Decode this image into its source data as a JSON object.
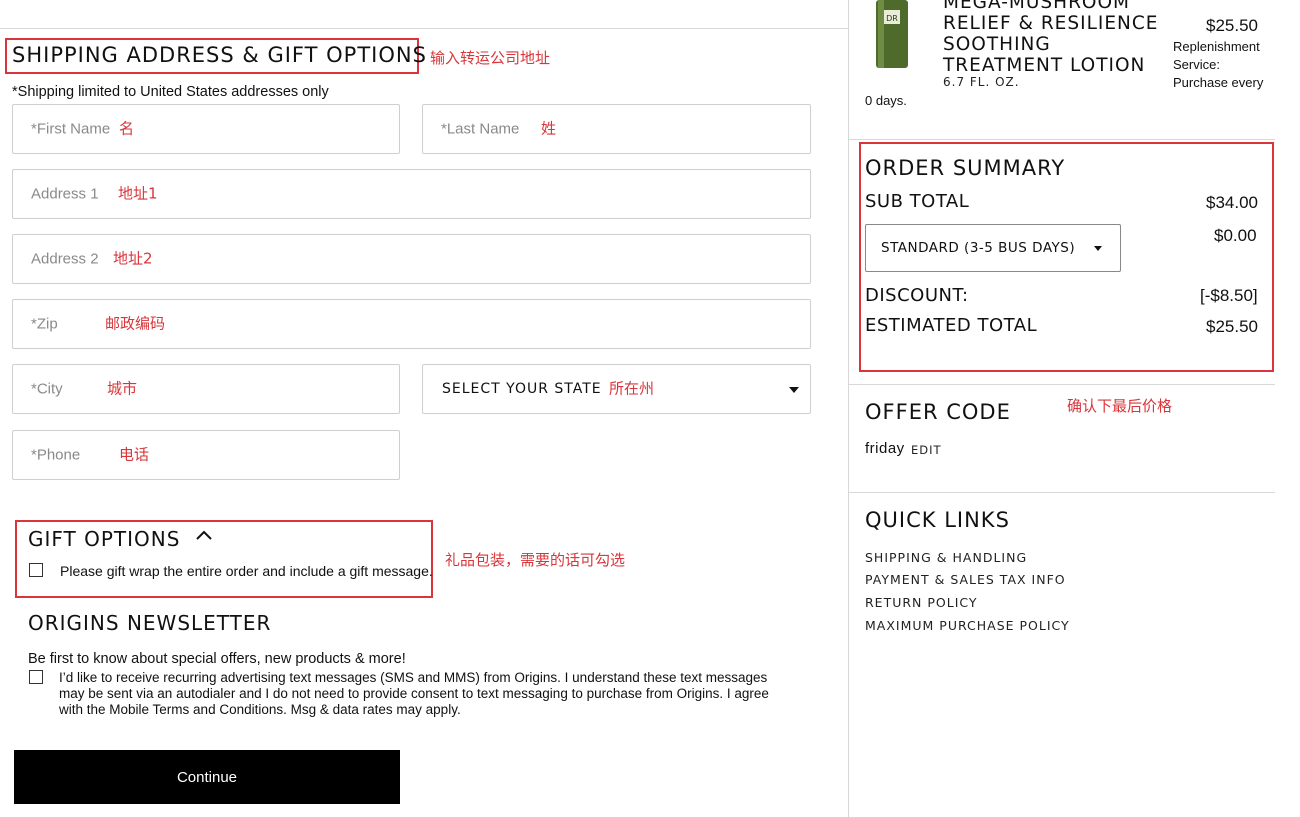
{
  "shipping": {
    "title": "SHIPPING ADDRESS & GIFT OPTIONS",
    "title_note": "输入转运公司地址",
    "restriction": "*Shipping limited to United States addresses only",
    "fields": {
      "first_name": {
        "placeholder": "*First Name",
        "note": "名"
      },
      "last_name": {
        "placeholder": "*Last Name",
        "note": "姓"
      },
      "address1": {
        "placeholder": "Address 1",
        "note": "地址1"
      },
      "address2": {
        "placeholder": "Address 2",
        "note": "地址2"
      },
      "zip": {
        "placeholder": "*Zip",
        "note": "邮政编码"
      },
      "city": {
        "placeholder": "*City",
        "note": "城市"
      },
      "state": {
        "placeholder": "SELECT YOUR STATE",
        "note": "所在州"
      },
      "phone": {
        "placeholder": "*Phone",
        "note": "电话"
      }
    }
  },
  "gift": {
    "title": "GIFT OPTIONS",
    "label": "Please gift wrap the entire order and include a gift message.",
    "note": "礼品包装，需要的话可勾选"
  },
  "newsletter": {
    "title": "ORIGINS NEWSLETTER",
    "intro": "Be first to know about special offers, new products & more!",
    "sms_line1": "I’d like to receive recurring advertising text messages (SMS and MMS) from Origins. I understand these text messages",
    "sms_line2": "may be sent via an autodialer and I do not need to provide consent to text messaging to purchase from Origins. I agree",
    "sms_line3": "with the Mobile Terms and Conditions. Msg & data rates may apply."
  },
  "continue_label": "Continue",
  "product": {
    "name_line1": "MEGA-MUSHROOM",
    "name_line2": "RELIEF & RESILIENCE",
    "name_line3": "SOOTHING",
    "name_line4": "TREATMENT LOTION",
    "size": "6.7 FL. OZ.",
    "price": "$25.50",
    "replenish_line1": "Replenishment",
    "replenish_line2": "Service:",
    "replenish_line3": "Purchase every",
    "days": "0 days."
  },
  "summary": {
    "title": "ORDER SUMMARY",
    "subtotal_label": "SUB TOTAL",
    "subtotal_value": "$34.00",
    "shipping_select": "STANDARD (3-5 BUS DAYS)",
    "shipping_value": "$0.00",
    "discount_label": "DISCOUNT:",
    "discount_value": "[-$8.50]",
    "total_label": "ESTIMATED TOTAL",
    "total_value": "$25.50",
    "note": "确认下最后价格"
  },
  "offer": {
    "title": "OFFER CODE",
    "code": "friday",
    "edit": "EDIT"
  },
  "quick_links": {
    "title": "QUICK LINKS",
    "items": [
      "SHIPPING & HANDLING",
      "PAYMENT & SALES TAX INFO",
      "RETURN POLICY",
      "MAXIMUM PURCHASE POLICY"
    ]
  },
  "colors": {
    "annotation": "#d9353a",
    "button": "#000000"
  }
}
